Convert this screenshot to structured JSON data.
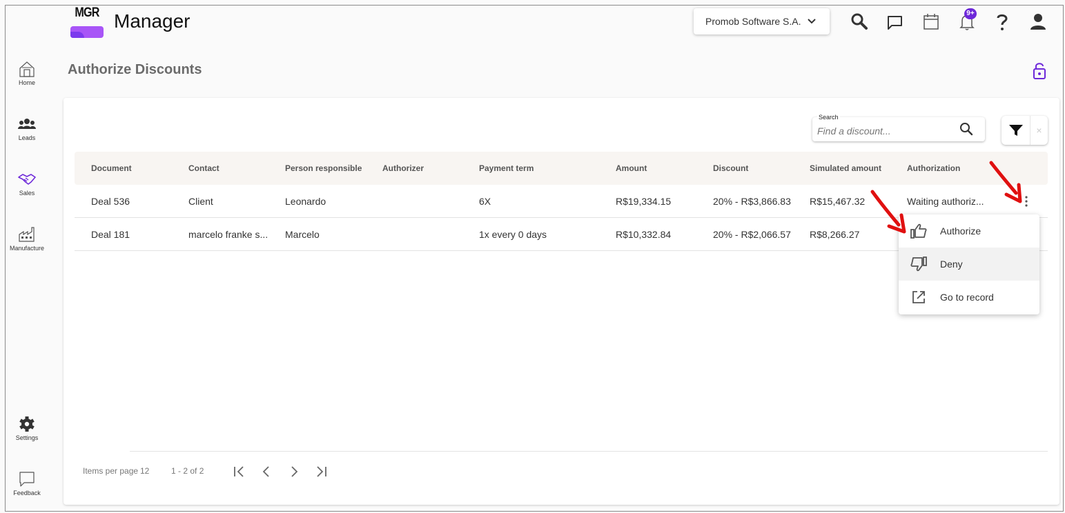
{
  "app": {
    "logo_text": "MGR",
    "title": "Manager",
    "brand_color": "#a855f7",
    "accent_color": "#6d28d9"
  },
  "header": {
    "company": "Promob Software S.A.",
    "notification_badge": "9+",
    "icons": [
      "search-icon",
      "chat-icon",
      "calendar-icon",
      "bell-icon",
      "help-icon",
      "user-icon"
    ]
  },
  "sidebar": {
    "items": [
      {
        "label": "Home",
        "icon": "home-icon"
      },
      {
        "label": "Leads",
        "icon": "people-icon"
      },
      {
        "label": "Sales",
        "icon": "handshake-icon"
      },
      {
        "label": "Manufacture",
        "icon": "factory-icon"
      },
      {
        "label": "Settings",
        "icon": "gear-icon"
      },
      {
        "label": "Feedback",
        "icon": "feedback-icon"
      }
    ]
  },
  "page": {
    "title": "Authorize Discounts"
  },
  "search": {
    "label": "Search",
    "placeholder": "Find a discount..."
  },
  "filter": {
    "clear_symbol": "×"
  },
  "table": {
    "columns": [
      "Document",
      "Contact",
      "Person responsible",
      "Authorizer",
      "Payment term",
      "Amount",
      "Discount",
      "Simulated amount",
      "Authorization"
    ],
    "rows": [
      {
        "document": "Deal 536",
        "contact": "Client",
        "person_responsible": "Leonardo",
        "authorizer": "",
        "payment_term": "6X",
        "amount": "R$19,334.15",
        "discount": "20% - R$3,866.83",
        "simulated_amount": "R$15,467.32",
        "authorization": "Waiting authoriz..."
      },
      {
        "document": "Deal 181",
        "contact": "marcelo franke s...",
        "person_responsible": "Marcelo",
        "authorizer": "",
        "payment_term": "1x every 0 days",
        "amount": "R$10,332.84",
        "discount": "20% - R$2,066.57",
        "simulated_amount": "R$8,266.27",
        "authorization": ""
      }
    ]
  },
  "context_menu": {
    "items": [
      {
        "label": "Authorize",
        "icon": "thumbs-up-icon"
      },
      {
        "label": "Deny",
        "icon": "thumbs-down-icon"
      },
      {
        "label": "Go to record",
        "icon": "open-external-icon"
      }
    ]
  },
  "pagination": {
    "items_per_page_label": "Items per page",
    "items_per_page": "12",
    "range": "1 - 2 of 2"
  },
  "annotations": {
    "arrow_color": "#e01010"
  }
}
